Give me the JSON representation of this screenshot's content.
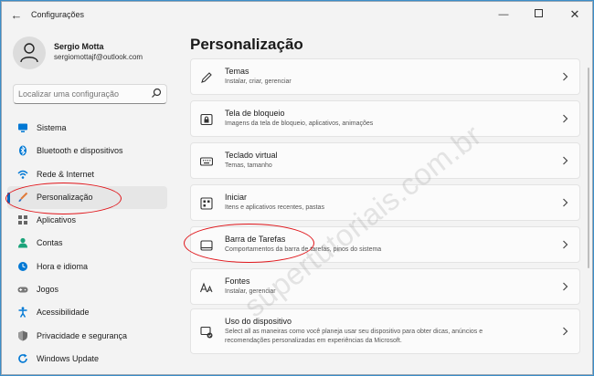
{
  "window": {
    "title": "Configurações",
    "back_icon": "back-arrow-icon",
    "controls": [
      "minimize-icon",
      "maximize-icon",
      "close-icon"
    ]
  },
  "profile": {
    "name": "Sergio Motta",
    "email": "sergiomottajf@outlook.com"
  },
  "search": {
    "placeholder": "Localizar uma configuração"
  },
  "sidebar": {
    "items": [
      {
        "label": "Sistema",
        "icon": "monitor-icon",
        "color": "#0078d4"
      },
      {
        "label": "Bluetooth e dispositivos",
        "icon": "bluetooth-icon",
        "color": "#0078d4"
      },
      {
        "label": "Rede & Internet",
        "icon": "wifi-icon",
        "color": "#0078d4"
      },
      {
        "label": "Personalização",
        "icon": "brush-icon",
        "color": "#e07b39",
        "active": true
      },
      {
        "label": "Aplicativos",
        "icon": "apps-icon",
        "color": "#555555"
      },
      {
        "label": "Contas",
        "icon": "person-icon",
        "color": "#1aa37a"
      },
      {
        "label": "Hora e idioma",
        "icon": "globe-clock-icon",
        "color": "#0078d4"
      },
      {
        "label": "Jogos",
        "icon": "gamepad-icon",
        "color": "#777777"
      },
      {
        "label": "Acessibilidade",
        "icon": "accessibility-icon",
        "color": "#0078d4"
      },
      {
        "label": "Privacidade e segurança",
        "icon": "shield-icon",
        "color": "#555555"
      },
      {
        "label": "Windows Update",
        "icon": "update-icon",
        "color": "#0078d4"
      }
    ]
  },
  "main": {
    "title": "Personalização",
    "cards": [
      {
        "title": "Temas",
        "subtitle": "Instalar, criar, gerenciar",
        "icon": "pen-icon"
      },
      {
        "title": "Tela de bloqueio",
        "subtitle": "Imagens da tela de bloqueio, aplicativos, animações",
        "icon": "lock-screen-icon"
      },
      {
        "title": "Teclado virtual",
        "subtitle": "Temas, tamanho",
        "icon": "keyboard-icon"
      },
      {
        "title": "Iniciar",
        "subtitle": "Itens e aplicativos recentes, pastas",
        "icon": "start-grid-icon"
      },
      {
        "title": "Barra de Tarefas",
        "subtitle": "Comportamentos da barra de tarefas, pinos do sistema",
        "icon": "taskbar-icon"
      },
      {
        "title": "Fontes",
        "subtitle": "Instalar, gerenciar",
        "icon": "fonts-icon"
      },
      {
        "title": "Uso do dispositivo",
        "subtitle": "Select all as maneiras como você planeja usar seu dispositivo para obter dicas, anúncios e",
        "subtitle2": "recomendações personalizadas em experiências da Microsoft.",
        "icon": "device-usage-icon"
      }
    ]
  },
  "watermark": "supertutoriais.com.br",
  "annotation_color": "#e0161b"
}
